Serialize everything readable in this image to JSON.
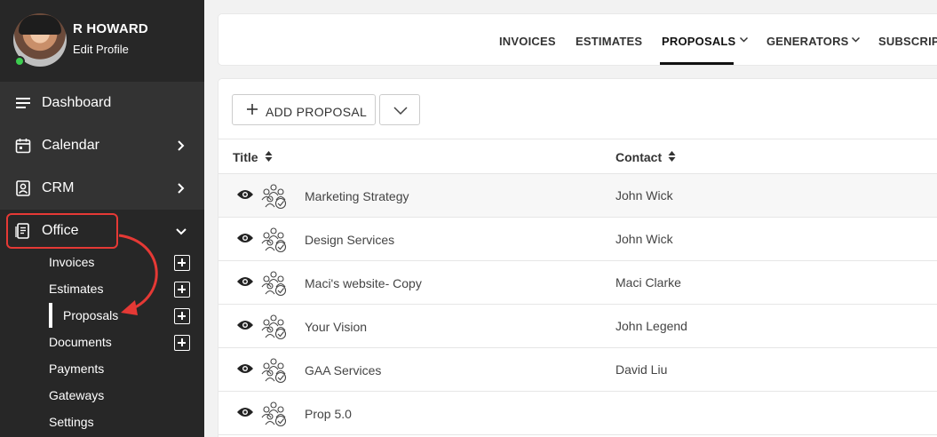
{
  "profile": {
    "name": "R HOWARD",
    "edit_label": "Edit Profile"
  },
  "sidebar": {
    "items": [
      {
        "label": "Dashboard"
      },
      {
        "label": "Calendar"
      },
      {
        "label": "CRM"
      },
      {
        "label": "Office"
      }
    ],
    "office_subitems": [
      {
        "label": "Invoices"
      },
      {
        "label": "Estimates"
      },
      {
        "label": "Proposals"
      },
      {
        "label": "Documents"
      },
      {
        "label": "Payments"
      },
      {
        "label": "Gateways"
      },
      {
        "label": "Settings"
      }
    ]
  },
  "tabs": [
    {
      "label": "INVOICES"
    },
    {
      "label": "ESTIMATES"
    },
    {
      "label": "PROPOSALS"
    },
    {
      "label": "GENERATORS"
    },
    {
      "label": "SUBSCRIPTIONS"
    }
  ],
  "toolbar": {
    "add_label": "ADD PROPOSAL"
  },
  "table": {
    "columns": [
      "Title",
      "Contact"
    ],
    "rows": [
      {
        "title": "Marketing Strategy",
        "contact": "John Wick"
      },
      {
        "title": "Design Services",
        "contact": "John Wick"
      },
      {
        "title": "Maci's website- Copy",
        "contact": "Maci Clarke"
      },
      {
        "title": "Your Vision",
        "contact": "John Legend"
      },
      {
        "title": "GAA Services",
        "contact": "David Liu"
      },
      {
        "title": "Prop 5.0",
        "contact": ""
      }
    ]
  },
  "colors": {
    "sidebar_bg": "#272727",
    "highlight": "#e53935",
    "online": "#3ccd4f"
  }
}
